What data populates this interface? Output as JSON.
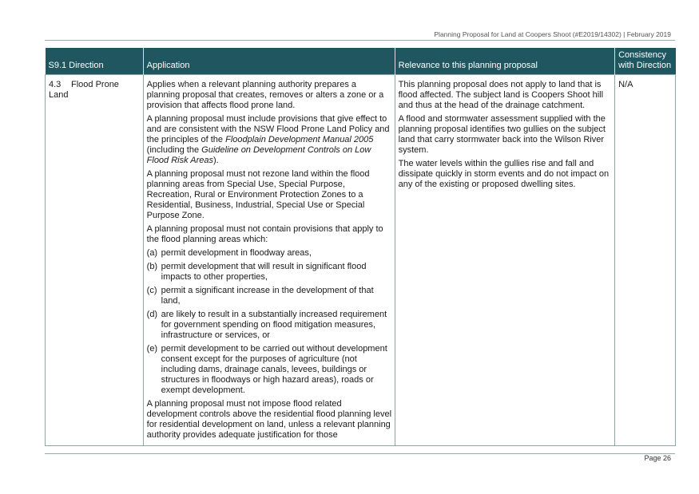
{
  "header": {
    "running_title": "Planning Proposal for Land at Coopers Shoot (#E2019/14302)   |   February 2019"
  },
  "table": {
    "headers": {
      "direction": "S9.1 Direction",
      "application": "Application",
      "relevance": "Relevance to this planning proposal",
      "consistency": "Consistency with Direction"
    },
    "row": {
      "direction_number": "4.3",
      "direction_name": "Flood Prone Land",
      "application": {
        "para1": "Applies when a relevant planning authority prepares a planning proposal that creates, removes or alters a zone or a provision that affects flood prone land.",
        "para2_pre": "A planning proposal must include provisions that give effect to and are consistent with the NSW Flood Prone Land Policy and the principles of the ",
        "para2_ital1": "Floodplain Development Manual 2005",
        "para2_mid": " (including the ",
        "para2_ital2": "Guideline on Development Controls on Low Flood Risk Areas",
        "para2_post": ").",
        "para3": "A planning proposal must not rezone land within the flood planning areas from Special Use, Special Purpose, Recreation, Rural or Environment Protection Zones to a Residential, Business, Industrial, Special Use or Special Purpose Zone.",
        "para4": "A planning proposal must not contain provisions that apply to the flood planning areas which:",
        "clauses": [
          {
            "label": "(a)",
            "text": "permit development in floodway areas,"
          },
          {
            "label": "(b)",
            "text": "permit development that will result in significant flood impacts to other properties,"
          },
          {
            "label": "(c)",
            "text": "permit a significant increase in the development of that land,"
          },
          {
            "label": "(d)",
            "text": "are likely to result in a substantially increased requirement for government spending on flood mitigation measures, infrastructure or services, or"
          },
          {
            "label": "(e)",
            "text": "permit development to be carried out without development consent except for the purposes of agriculture (not including dams, drainage canals, levees, buildings or structures in floodways or high hazard areas), roads or exempt development."
          }
        ],
        "para5": "A planning proposal must not impose flood related development controls above the residential flood planning level for residential development on land, unless a relevant planning authority provides adequate justification for those"
      },
      "relevance": {
        "para1": "This planning proposal does not apply to land that is flood affected. The subject land is Coopers Shoot hill and thus at the head of the drainage catchment.",
        "para2": "A flood and stormwater assessment supplied with the planning proposal identifies two gullies on the subject land that carry stormwater back into the Wilson River system.",
        "para3": "The water levels within the gullies rise and fall and dissipate quickly in storm events and do not impact on any of the existing or proposed dwelling sites."
      },
      "consistency": "N/A"
    }
  },
  "footer": {
    "page_label": "Page 26"
  }
}
